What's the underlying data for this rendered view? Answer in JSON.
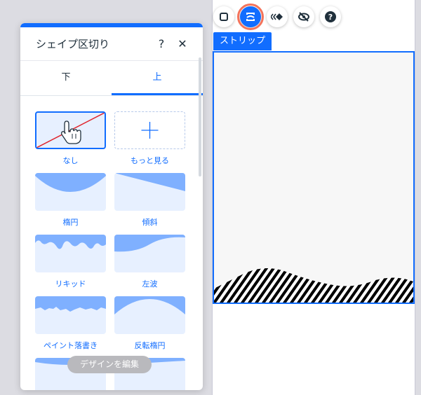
{
  "panel": {
    "title": "シェイプ区切り",
    "help_label": "?",
    "close_label": "✕",
    "tabs": [
      {
        "label": "下",
        "active": false
      },
      {
        "label": "上",
        "active": true
      }
    ],
    "shapes": [
      {
        "label": "なし",
        "selected": true
      },
      {
        "label": "もっと見る",
        "selected": false
      },
      {
        "label": "楕円",
        "selected": false
      },
      {
        "label": "傾斜",
        "selected": false
      },
      {
        "label": "リキッド",
        "selected": false
      },
      {
        "label": "左波",
        "selected": false
      },
      {
        "label": "ペイント落書き",
        "selected": false
      },
      {
        "label": "反転楕円",
        "selected": false
      }
    ],
    "edit_button_label": "デザインを編集"
  },
  "canvas": {
    "strip_label": "ストリップ",
    "toolbar_icons": [
      "square-icon",
      "shape-divider-icon",
      "animation-icon",
      "hide-icon",
      "help-icon"
    ],
    "toolbar_active": "shape-divider-icon"
  },
  "colors": {
    "accent": "#116dff",
    "highlight": "#f4735b",
    "shape_fill": "#7fb0ff",
    "thumb_bg": "#e7f0ff"
  }
}
